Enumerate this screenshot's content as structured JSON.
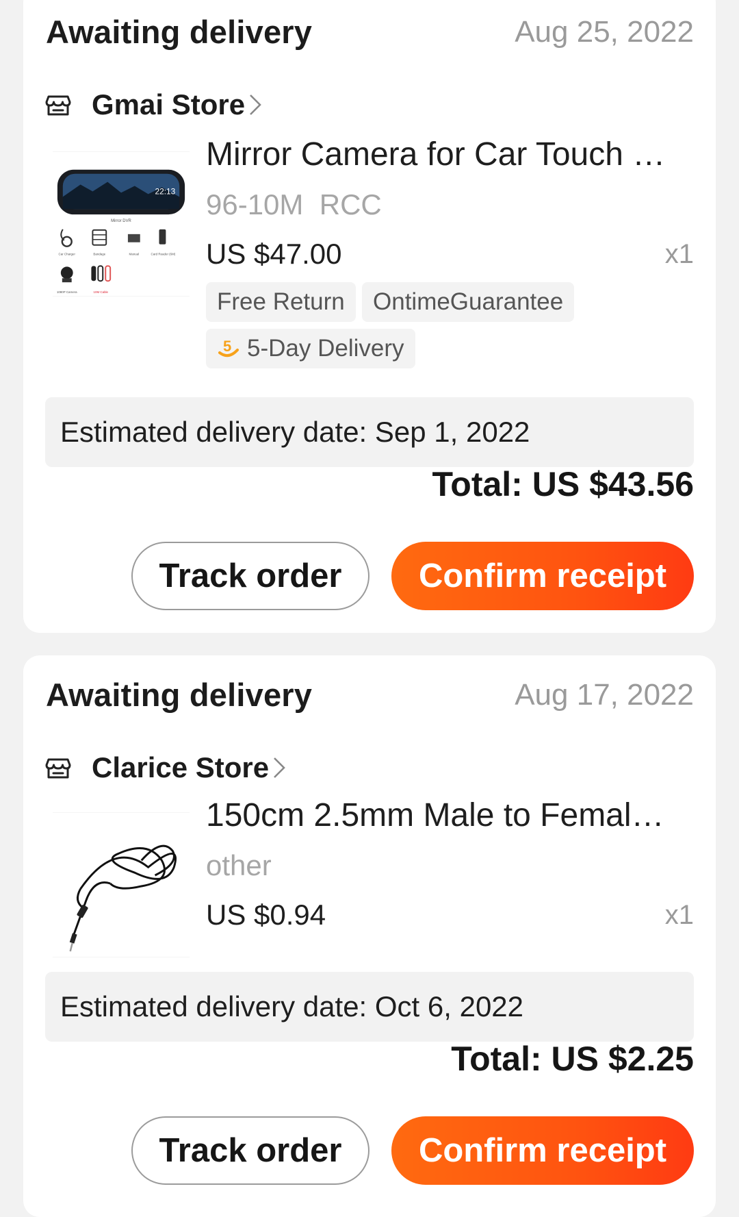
{
  "orders": [
    {
      "status": "Awaiting delivery",
      "date": "Aug 25, 2022",
      "store": "Gmai Store",
      "product_title": "Mirror Camera for Car Touch …",
      "variant": "96-10M  RCC",
      "price": "US $47.00",
      "quantity": "x1",
      "tags": [
        "Free Return",
        "OntimeGuarantee"
      ],
      "delivery_tag": "5-Day Delivery",
      "estimated_delivery": "Estimated delivery date: Sep 1, 2022",
      "total": "Total: US $43.56",
      "track_label": "Track order",
      "confirm_label": "Confirm receipt",
      "thumbnail": {
        "screen_time": "22:13",
        "captions": [
          "Mirror DVR",
          "Car Charger",
          "Bandage",
          "Manual",
          "Card Reader (6M)",
          "1080P Camera",
          "10M Cable"
        ]
      }
    },
    {
      "status": "Awaiting delivery",
      "date": "Aug 17, 2022",
      "store": "Clarice Store",
      "product_title": "150cm 2.5mm Male to Femal…",
      "variant": "other",
      "price": "US $0.94",
      "quantity": "x1",
      "estimated_delivery": "Estimated delivery date: Oct 6, 2022",
      "total": "Total: US $2.25",
      "track_label": "Track order",
      "confirm_label": "Confirm receipt"
    }
  ],
  "icons": {
    "store": "store-icon",
    "chevron": "chevron-right-icon",
    "delivery": "fast-delivery-icon"
  },
  "colors": {
    "accent": "#ff5a10",
    "delivery_icon": "#f7a21b",
    "muted_text": "#9a9a9a"
  }
}
